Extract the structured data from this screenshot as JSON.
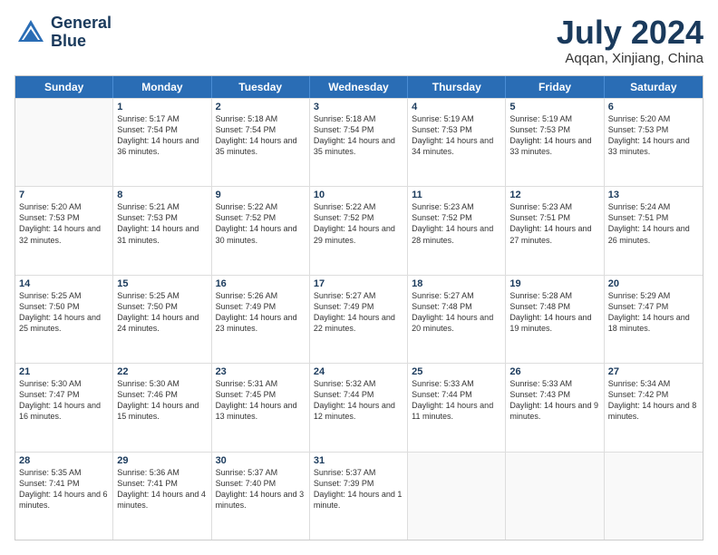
{
  "logo": {
    "line1": "General",
    "line2": "Blue"
  },
  "title": {
    "month_year": "July 2024",
    "location": "Aqqan, Xinjiang, China"
  },
  "header_days": [
    "Sunday",
    "Monday",
    "Tuesday",
    "Wednesday",
    "Thursday",
    "Friday",
    "Saturday"
  ],
  "weeks": [
    [
      {
        "day": "",
        "empty": true
      },
      {
        "day": "1",
        "sunrise": "Sunrise: 5:17 AM",
        "sunset": "Sunset: 7:54 PM",
        "daylight": "Daylight: 14 hours and 36 minutes."
      },
      {
        "day": "2",
        "sunrise": "Sunrise: 5:18 AM",
        "sunset": "Sunset: 7:54 PM",
        "daylight": "Daylight: 14 hours and 35 minutes."
      },
      {
        "day": "3",
        "sunrise": "Sunrise: 5:18 AM",
        "sunset": "Sunset: 7:54 PM",
        "daylight": "Daylight: 14 hours and 35 minutes."
      },
      {
        "day": "4",
        "sunrise": "Sunrise: 5:19 AM",
        "sunset": "Sunset: 7:53 PM",
        "daylight": "Daylight: 14 hours and 34 minutes."
      },
      {
        "day": "5",
        "sunrise": "Sunrise: 5:19 AM",
        "sunset": "Sunset: 7:53 PM",
        "daylight": "Daylight: 14 hours and 33 minutes."
      },
      {
        "day": "6",
        "sunrise": "Sunrise: 5:20 AM",
        "sunset": "Sunset: 7:53 PM",
        "daylight": "Daylight: 14 hours and 33 minutes."
      }
    ],
    [
      {
        "day": "7",
        "sunrise": "Sunrise: 5:20 AM",
        "sunset": "Sunset: 7:53 PM",
        "daylight": "Daylight: 14 hours and 32 minutes."
      },
      {
        "day": "8",
        "sunrise": "Sunrise: 5:21 AM",
        "sunset": "Sunset: 7:53 PM",
        "daylight": "Daylight: 14 hours and 31 minutes."
      },
      {
        "day": "9",
        "sunrise": "Sunrise: 5:22 AM",
        "sunset": "Sunset: 7:52 PM",
        "daylight": "Daylight: 14 hours and 30 minutes."
      },
      {
        "day": "10",
        "sunrise": "Sunrise: 5:22 AM",
        "sunset": "Sunset: 7:52 PM",
        "daylight": "Daylight: 14 hours and 29 minutes."
      },
      {
        "day": "11",
        "sunrise": "Sunrise: 5:23 AM",
        "sunset": "Sunset: 7:52 PM",
        "daylight": "Daylight: 14 hours and 28 minutes."
      },
      {
        "day": "12",
        "sunrise": "Sunrise: 5:23 AM",
        "sunset": "Sunset: 7:51 PM",
        "daylight": "Daylight: 14 hours and 27 minutes."
      },
      {
        "day": "13",
        "sunrise": "Sunrise: 5:24 AM",
        "sunset": "Sunset: 7:51 PM",
        "daylight": "Daylight: 14 hours and 26 minutes."
      }
    ],
    [
      {
        "day": "14",
        "sunrise": "Sunrise: 5:25 AM",
        "sunset": "Sunset: 7:50 PM",
        "daylight": "Daylight: 14 hours and 25 minutes."
      },
      {
        "day": "15",
        "sunrise": "Sunrise: 5:25 AM",
        "sunset": "Sunset: 7:50 PM",
        "daylight": "Daylight: 14 hours and 24 minutes."
      },
      {
        "day": "16",
        "sunrise": "Sunrise: 5:26 AM",
        "sunset": "Sunset: 7:49 PM",
        "daylight": "Daylight: 14 hours and 23 minutes."
      },
      {
        "day": "17",
        "sunrise": "Sunrise: 5:27 AM",
        "sunset": "Sunset: 7:49 PM",
        "daylight": "Daylight: 14 hours and 22 minutes."
      },
      {
        "day": "18",
        "sunrise": "Sunrise: 5:27 AM",
        "sunset": "Sunset: 7:48 PM",
        "daylight": "Daylight: 14 hours and 20 minutes."
      },
      {
        "day": "19",
        "sunrise": "Sunrise: 5:28 AM",
        "sunset": "Sunset: 7:48 PM",
        "daylight": "Daylight: 14 hours and 19 minutes."
      },
      {
        "day": "20",
        "sunrise": "Sunrise: 5:29 AM",
        "sunset": "Sunset: 7:47 PM",
        "daylight": "Daylight: 14 hours and 18 minutes."
      }
    ],
    [
      {
        "day": "21",
        "sunrise": "Sunrise: 5:30 AM",
        "sunset": "Sunset: 7:47 PM",
        "daylight": "Daylight: 14 hours and 16 minutes."
      },
      {
        "day": "22",
        "sunrise": "Sunrise: 5:30 AM",
        "sunset": "Sunset: 7:46 PM",
        "daylight": "Daylight: 14 hours and 15 minutes."
      },
      {
        "day": "23",
        "sunrise": "Sunrise: 5:31 AM",
        "sunset": "Sunset: 7:45 PM",
        "daylight": "Daylight: 14 hours and 13 minutes."
      },
      {
        "day": "24",
        "sunrise": "Sunrise: 5:32 AM",
        "sunset": "Sunset: 7:44 PM",
        "daylight": "Daylight: 14 hours and 12 minutes."
      },
      {
        "day": "25",
        "sunrise": "Sunrise: 5:33 AM",
        "sunset": "Sunset: 7:44 PM",
        "daylight": "Daylight: 14 hours and 11 minutes."
      },
      {
        "day": "26",
        "sunrise": "Sunrise: 5:33 AM",
        "sunset": "Sunset: 7:43 PM",
        "daylight": "Daylight: 14 hours and 9 minutes."
      },
      {
        "day": "27",
        "sunrise": "Sunrise: 5:34 AM",
        "sunset": "Sunset: 7:42 PM",
        "daylight": "Daylight: 14 hours and 8 minutes."
      }
    ],
    [
      {
        "day": "28",
        "sunrise": "Sunrise: 5:35 AM",
        "sunset": "Sunset: 7:41 PM",
        "daylight": "Daylight: 14 hours and 6 minutes."
      },
      {
        "day": "29",
        "sunrise": "Sunrise: 5:36 AM",
        "sunset": "Sunset: 7:41 PM",
        "daylight": "Daylight: 14 hours and 4 minutes."
      },
      {
        "day": "30",
        "sunrise": "Sunrise: 5:37 AM",
        "sunset": "Sunset: 7:40 PM",
        "daylight": "Daylight: 14 hours and 3 minutes."
      },
      {
        "day": "31",
        "sunrise": "Sunrise: 5:37 AM",
        "sunset": "Sunset: 7:39 PM",
        "daylight": "Daylight: 14 hours and 1 minute."
      },
      {
        "day": "",
        "empty": true
      },
      {
        "day": "",
        "empty": true
      },
      {
        "day": "",
        "empty": true
      }
    ]
  ]
}
